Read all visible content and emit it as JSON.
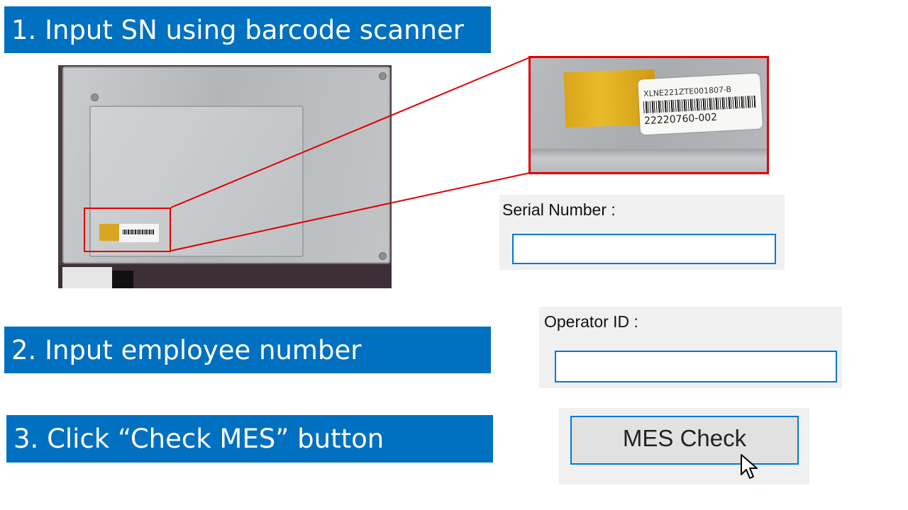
{
  "steps": {
    "step1": "1. Input SN using barcode scanner",
    "step2": "2. Input employee number",
    "step3": "3. Click “Check MES” button"
  },
  "zoom_label": {
    "code": "XLNE221ZTE001807-B",
    "number": "22220760-002"
  },
  "serial_form": {
    "label": "Serial Number :",
    "value": ""
  },
  "operator_form": {
    "label": "Operator ID :",
    "value": ""
  },
  "mes_button": {
    "label": "MES Check"
  },
  "colors": {
    "step_banner": "#0070c0",
    "highlight": "#e00000",
    "input_border": "#0078d7",
    "panel_bg": "#f0f0f0"
  },
  "icons": {
    "cursor": "arrow-cursor-icon"
  }
}
